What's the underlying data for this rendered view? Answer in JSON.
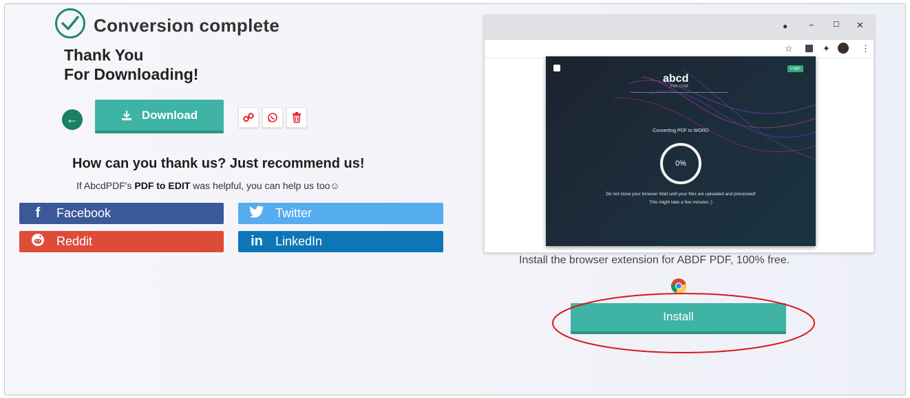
{
  "status": {
    "title": "Conversion complete",
    "thanks_line1": "Thank You",
    "thanks_line2": "For Downloading!"
  },
  "actions": {
    "back_icon": "arrow-left-icon",
    "download_label": "Download",
    "download_icon": "download-icon",
    "link_icon": "link-icon",
    "whatsapp_icon": "whatsapp-icon",
    "delete_icon": "trash-icon"
  },
  "share": {
    "heading": "How can you thank us? Just recommend us!",
    "sub_prefix": "If AbcdPDF's",
    "sub_bold": "PDF to EDIT",
    "sub_suffix": "was helpful, you can help us too☺",
    "buttons": {
      "facebook": "Facebook",
      "twitter": "Twitter",
      "reddit": "Reddit",
      "linkedin": "LinkedIn"
    },
    "colors": {
      "facebook": "#3b5998",
      "twitter": "#55acee",
      "reddit": "#dd4b39",
      "linkedin": "#0e76b7"
    }
  },
  "extension_preview": {
    "window_controls": [
      "−",
      "☐",
      "✕"
    ],
    "toolbar_icons": [
      "star-icon",
      "extension-icon",
      "puzzle-icon",
      "avatar",
      "menu-icon"
    ],
    "logo": "abcd",
    "logo_sub": "PDF.COM",
    "login": "Login",
    "converting": "Converting PDF to WORD",
    "progress": "0%",
    "note1": "Do not close your browser Wait until your files are uploaded and processed!",
    "note2": "This might take a few minutes :)"
  },
  "install": {
    "description": "Install the browser extension for ABDF PDF, 100% free.",
    "button_label": "Install",
    "browser_icon": "chrome-icon",
    "accent": "#3fb3a4",
    "highlight_color": "#d9161d"
  }
}
